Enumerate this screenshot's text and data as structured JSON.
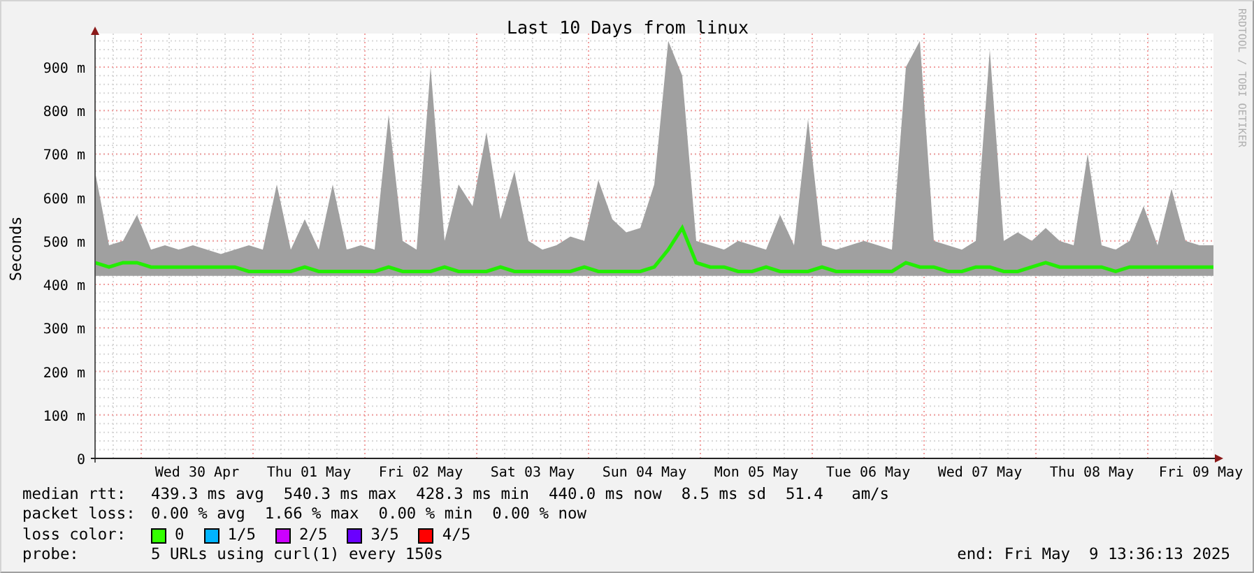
{
  "graph": {
    "watermark": "RRDTOOL / TOBI OETIKER",
    "chart_data": {
      "type": "line",
      "grid": true,
      "title": "Last 10 Days from linux",
      "ylabel": "Seconds",
      "ylim": [
        0,
        977
      ],
      "yticks": [
        {
          "value": 0,
          "label": "0"
        },
        {
          "value": 100,
          "label": "100 m"
        },
        {
          "value": 200,
          "label": "200 m"
        },
        {
          "value": 300,
          "label": "300 m"
        },
        {
          "value": 400,
          "label": "400 m"
        },
        {
          "value": 500,
          "label": "500 m"
        },
        {
          "value": 600,
          "label": "600 m"
        },
        {
          "value": 700,
          "label": "700 m"
        },
        {
          "value": 800,
          "label": "800 m"
        },
        {
          "value": 900,
          "label": "900 m"
        }
      ],
      "categories": [
        null,
        null,
        null,
        null,
        null,
        null,
        null,
        "Wed 30 Apr",
        null,
        null,
        null,
        null,
        null,
        null,
        null,
        "Thu 01 May",
        null,
        null,
        null,
        null,
        null,
        null,
        null,
        "Fri 02 May",
        null,
        null,
        null,
        null,
        null,
        null,
        null,
        "Sat 03 May",
        null,
        null,
        null,
        null,
        null,
        null,
        null,
        "Sun 04 May",
        null,
        null,
        null,
        null,
        null,
        null,
        null,
        "Mon 05 May",
        null,
        null,
        null,
        null,
        null,
        null,
        null,
        "Tue 06 May",
        null,
        null,
        null,
        null,
        null,
        null,
        null,
        "Wed 07 May",
        null,
        null,
        null,
        null,
        null,
        null,
        null,
        "Thu 08 May",
        null,
        null,
        null,
        null,
        null,
        null,
        null,
        "Fri 09 May",
        null
      ],
      "series": [
        {
          "type": "area",
          "color": "#a0a0a0",
          "values": [
            660,
            490,
            500,
            560,
            480,
            490,
            480,
            490,
            480,
            470,
            480,
            490,
            480,
            630,
            480,
            550,
            480,
            630,
            480,
            490,
            480,
            790,
            500,
            480,
            900,
            500,
            630,
            580,
            750,
            550,
            660,
            500,
            480,
            490,
            510,
            500,
            640,
            550,
            520,
            530,
            630,
            960,
            880,
            500,
            490,
            480,
            500,
            490,
            480,
            560,
            490,
            780,
            490,
            480,
            490,
            500,
            490,
            480,
            900,
            960,
            500,
            490,
            480,
            500,
            940,
            500,
            520,
            500,
            530,
            500,
            490,
            700,
            490,
            480,
            500,
            580,
            490,
            620,
            500,
            490,
            490
          ]
        },
        {
          "type": "line",
          "color": "#22ee00",
          "values": [
            450,
            440,
            450,
            450,
            440,
            440,
            440,
            440,
            440,
            440,
            440,
            430,
            430,
            430,
            430,
            440,
            430,
            430,
            430,
            430,
            430,
            440,
            430,
            430,
            430,
            440,
            430,
            430,
            430,
            440,
            430,
            430,
            430,
            430,
            430,
            440,
            430,
            430,
            430,
            430,
            440,
            480,
            530,
            450,
            440,
            440,
            430,
            430,
            440,
            430,
            430,
            430,
            440,
            430,
            430,
            430,
            430,
            430,
            450,
            440,
            440,
            430,
            430,
            440,
            440,
            430,
            430,
            440,
            450,
            440,
            440,
            440,
            440,
            430,
            440,
            440,
            440,
            440,
            440,
            440,
            440
          ]
        }
      ]
    }
  },
  "legend": {
    "rows": [
      {
        "kind": "stats",
        "label": "median rtt:",
        "values": [
          "439.3 ms avg",
          "540.3 ms max",
          "428.3 ms min",
          "440.0 ms now",
          "8.5 ms sd",
          "51.4   am/s"
        ]
      },
      {
        "kind": "stats",
        "label": "packet loss:",
        "values": [
          "0.00 % avg",
          "1.66 % max",
          "0.00 % min",
          "0.00 % now"
        ]
      },
      {
        "kind": "colors",
        "label": "loss color:",
        "items": [
          {
            "label": "0",
            "color": "#33ff00"
          },
          {
            "label": "1/5",
            "color": "#00b4ff"
          },
          {
            "label": "2/5",
            "color": "#cc00ff"
          },
          {
            "label": "3/5",
            "color": "#6a00ff"
          },
          {
            "label": "4/5",
            "color": "#ff0000"
          }
        ]
      },
      {
        "kind": "stats",
        "label": "probe:",
        "values": [
          "5 URLs using curl(1) every 150s"
        ]
      }
    ],
    "end": "end: Fri May  9 13:36:13 2025"
  }
}
